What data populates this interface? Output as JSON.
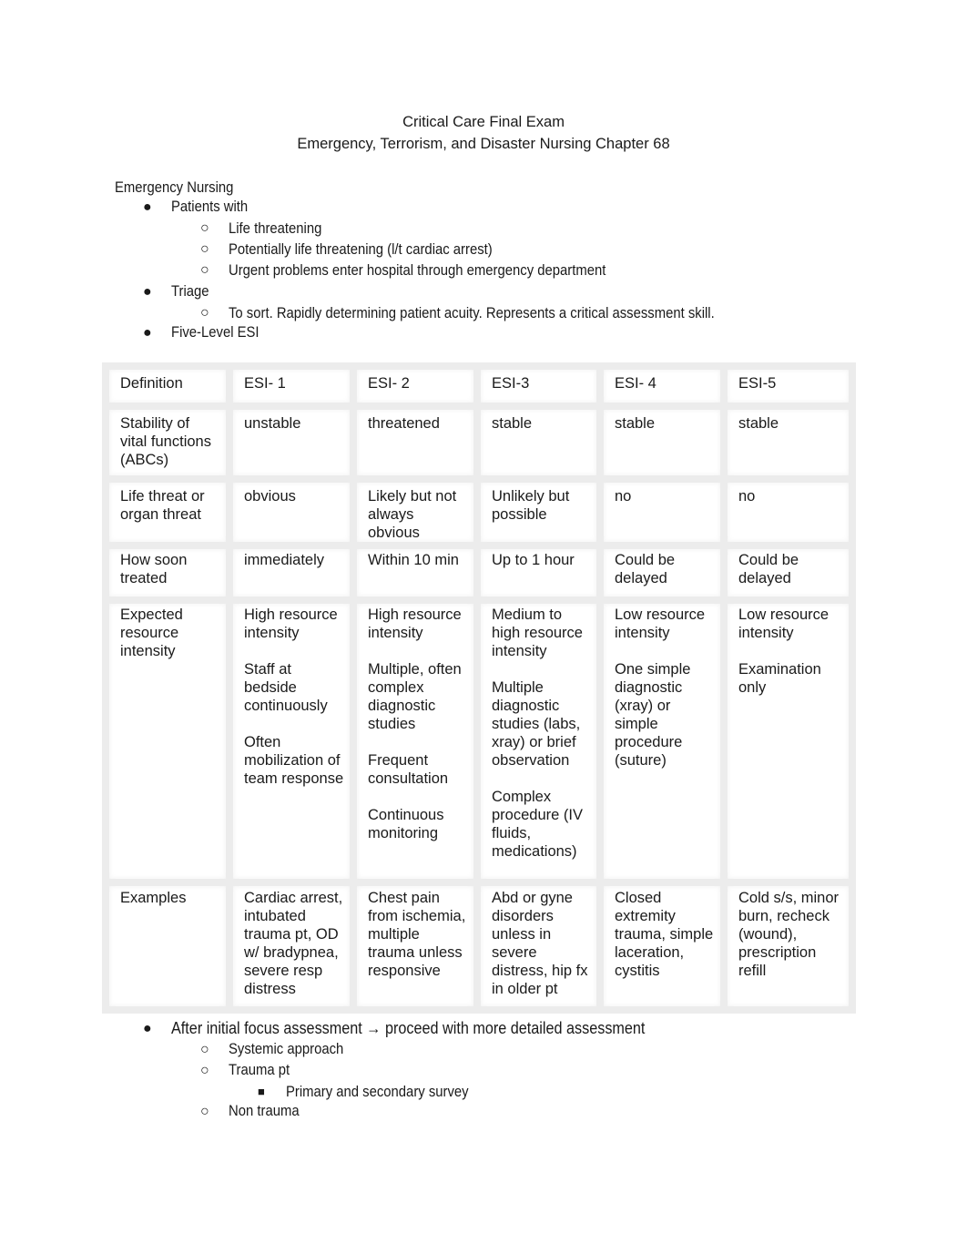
{
  "header": {
    "title": "Critical Care Final Exam",
    "subtitle": "Emergency, Terrorism, and Disaster Nursing Chapter 68"
  },
  "section_heading": "Emergency Nursing",
  "outline_top": [
    {
      "level": 1,
      "text": "Patients with"
    },
    {
      "level": 2,
      "text": "Life threatening"
    },
    {
      "level": 2,
      "text": "Potentially life threatening (l/t cardiac arrest)"
    },
    {
      "level": 2,
      "text": "Urgent problems enter hospital through emergency department"
    },
    {
      "level": 1,
      "text": "Triage"
    },
    {
      "level": 2,
      "text": "To sort. Rapidly determining patient acuity. Represents a critical assessment skill."
    },
    {
      "level": 1,
      "text": "Five-Level ESI"
    }
  ],
  "bullets": {
    "level1": "●",
    "level2": "○",
    "level3": "■"
  },
  "esi_table": {
    "headers": [
      "Definition",
      "ESI- 1",
      "ESI- 2",
      "ESI-3",
      "ESI- 4",
      "ESI-5"
    ],
    "rows": [
      [
        "Stability of vital functions (ABCs)",
        "unstable",
        "threatened",
        "stable",
        "stable",
        "stable"
      ],
      [
        "Life threat or organ threat",
        "obvious",
        "Likely but not always obvious",
        "Unlikely but possible",
        "no",
        "no"
      ],
      [
        "How soon treated",
        "immediately",
        "Within 10 min",
        "Up to 1 hour",
        "Could be delayed",
        "Could be delayed"
      ],
      [
        "Expected resource intensity",
        "High resource intensity\n\nStaff at bedside continuously\n\nOften mobilization of team response",
        "High resource intensity\n\nMultiple, often complex diagnostic studies\n\nFrequent consultation\n\nContinuous monitoring",
        "Medium to high resource intensity\n\nMultiple diagnostic studies (labs, xray) or brief observation\n\nComplex procedure (IV fluids, medications)",
        "Low resource intensity\n\nOne simple diagnostic (xray) or simple procedure (suture)",
        "Low resource intensity\n\nExamination only"
      ],
      [
        "Examples",
        "Cardiac arrest, intubated trauma pt, OD w/ bradypnea, severe resp distress",
        "Chest pain from ischemia, multiple trauma unless responsive",
        "Abd or gyne disorders unless in severe distress, hip fx in older pt",
        "Closed extremity trauma, simple laceration, cystitis",
        "Cold s/s, minor burn, recheck (wound), prescription refill"
      ]
    ]
  },
  "outline_bottom": [
    {
      "level": 1,
      "text": "After initial focus assessment → proceed with more detailed assessment"
    },
    {
      "level": 2,
      "text": "Systemic approach"
    },
    {
      "level": 2,
      "text": "Trauma pt"
    },
    {
      "level": 3,
      "text": "Primary and secondary survey"
    },
    {
      "level": 2,
      "text": "Non trauma"
    }
  ]
}
